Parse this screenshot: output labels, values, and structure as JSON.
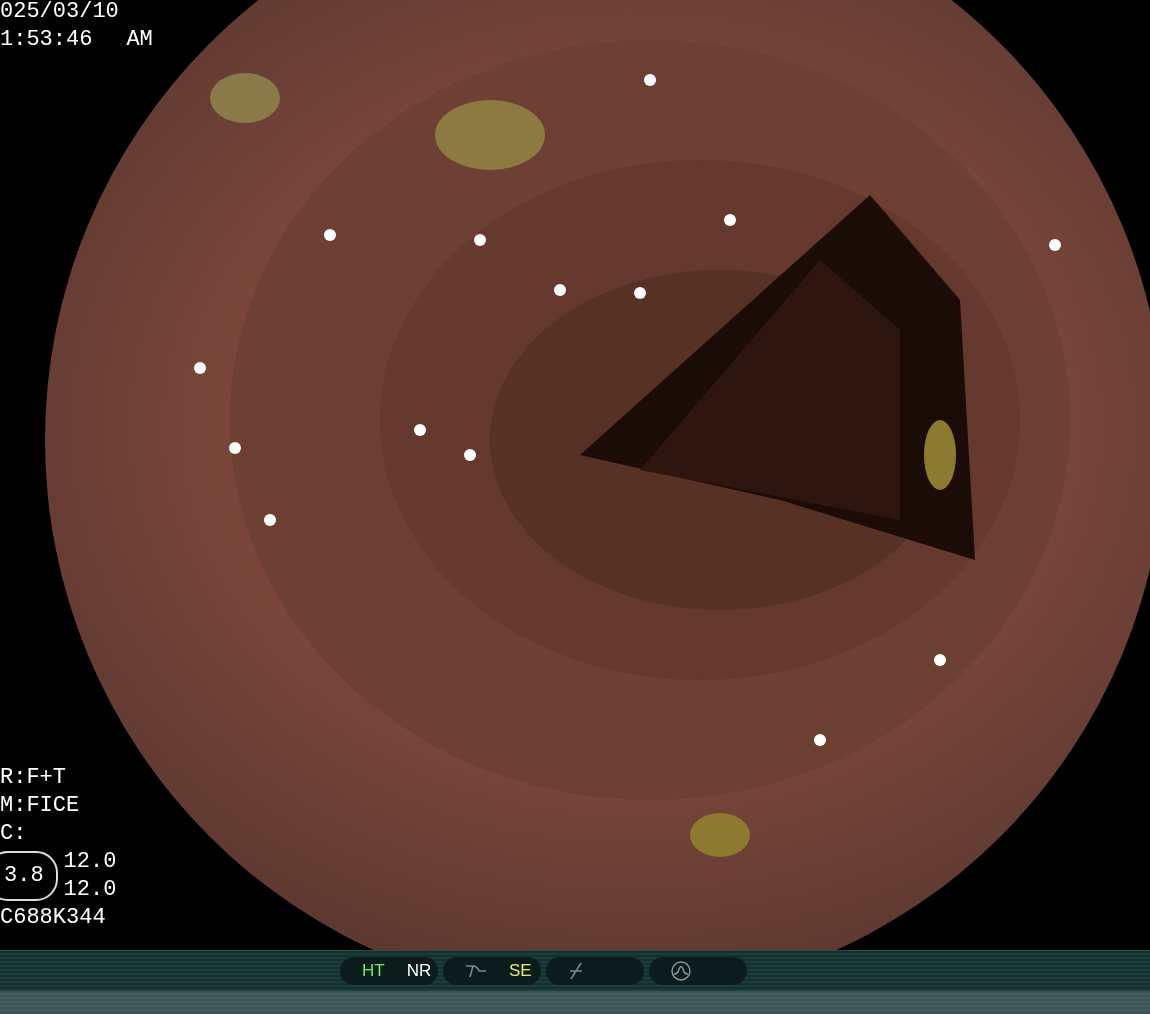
{
  "overlay_top": {
    "date": "025/03/10",
    "time": "1:53:46",
    "meridiem": "AM"
  },
  "overlay_bottom": {
    "lines": [
      "R:F+T",
      "M:FICE",
      "C:"
    ],
    "badge": "3.8",
    "readings": [
      "12.0",
      "12.0"
    ],
    "code": "C688K344"
  },
  "status_bar": {
    "groups": [
      {
        "kind": "labels",
        "items": [
          {
            "label": "HT",
            "color": "#6ee86e"
          },
          {
            "label": "NR",
            "color": "#ffffff"
          }
        ]
      },
      {
        "kind": "curve",
        "items": [
          {
            "label": "SE",
            "color": "#e8e86a"
          }
        ]
      },
      {
        "kind": "slash"
      },
      {
        "kind": "wave"
      }
    ]
  }
}
